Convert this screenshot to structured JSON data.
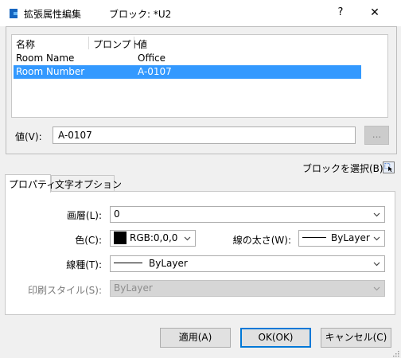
{
  "window": {
    "title": "拡張属性編集",
    "block_label": "ブロック: *U2",
    "help": "?",
    "close": "✕"
  },
  "attributes": {
    "columns": [
      "名称",
      "プロンプト",
      "値"
    ],
    "rows": [
      {
        "name": "Room Name",
        "prompt": "",
        "value": "Office",
        "selected": false
      },
      {
        "name": "Room Number",
        "prompt": "",
        "value": "A-0107",
        "selected": true
      }
    ]
  },
  "value_field": {
    "label": "値(V):",
    "value": "A-0107",
    "browse_label": "..."
  },
  "select_block": {
    "label": "ブロックを選択(B)",
    "icon": "select-pointer-icon"
  },
  "tabs": [
    {
      "label": "プロパティ",
      "active": true
    },
    {
      "label": "文字オプション",
      "active": false
    }
  ],
  "properties": {
    "layer": {
      "label": "画層(L):",
      "value": "0"
    },
    "color": {
      "label": "色(C):",
      "value": "RGB:0,0,0",
      "swatch": "#000000"
    },
    "lineweight": {
      "label": "線の太さ(W):",
      "value": "ByLayer"
    },
    "linetype": {
      "label": "線種(T):",
      "value": "ByLayer"
    },
    "plotstyle": {
      "label": "印刷スタイル(S):",
      "value": "ByLayer",
      "disabled": true
    }
  },
  "buttons": {
    "apply": "適用(A)",
    "ok": "OK(OK)",
    "cancel": "キャンセル(C)"
  },
  "colors": {
    "selection": "#3399ff",
    "accent": "#0078d7"
  }
}
